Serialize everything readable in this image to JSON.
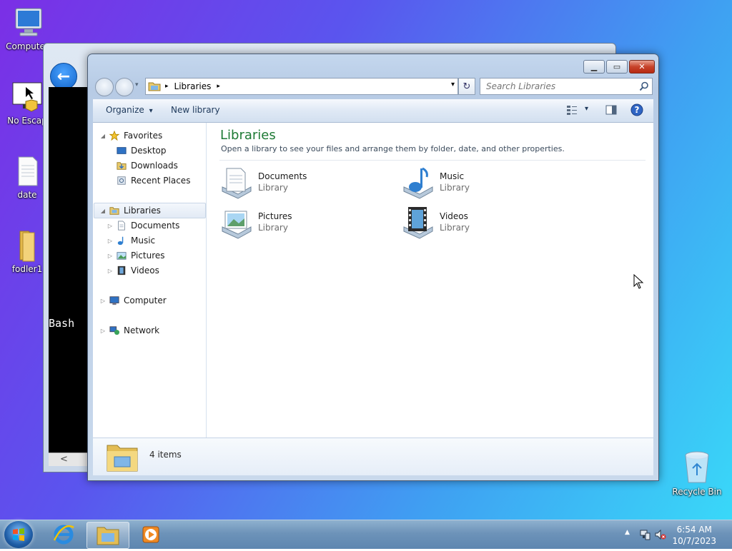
{
  "desktop": {
    "icons": [
      {
        "label": "Computer",
        "icon": "computer-icon"
      },
      {
        "label": "No Escap",
        "icon": "app-icon"
      },
      {
        "label": "date",
        "icon": "document-icon"
      },
      {
        "label": "fodler1",
        "icon": "folder-icon"
      },
      {
        "label": "Recycle Bin",
        "icon": "recycle-bin-icon"
      }
    ]
  },
  "background_window": {
    "terminal_text": "Bash",
    "back_glyph": "←",
    "scroll_glyph": "<"
  },
  "explorer": {
    "caption_buttons": {
      "minimize": "▁",
      "maximize": "▭",
      "close": "✕"
    },
    "address": {
      "root_arrow": "▸",
      "crumb": "Libraries",
      "crumb_arrow": "▸",
      "dropdown": "▾"
    },
    "refresh_glyph": "↻",
    "search": {
      "placeholder": "Search Libraries"
    },
    "toolbar": {
      "organize": "Organize",
      "organize_arrow": "▾",
      "new_library": "New library",
      "view_arrow": "▾"
    },
    "nav": {
      "favorites": "Favorites",
      "favorites_items": [
        "Desktop",
        "Downloads",
        "Recent Places"
      ],
      "libraries": "Libraries",
      "libraries_items": [
        "Documents",
        "Music",
        "Pictures",
        "Videos"
      ],
      "computer": "Computer",
      "network": "Network"
    },
    "main": {
      "title": "Libraries",
      "subtitle": "Open a library to see your files and arrange them by folder, date, and other properties.",
      "tiles": [
        {
          "name": "Documents",
          "type": "Library",
          "icon": "documents-library-icon"
        },
        {
          "name": "Music",
          "type": "Library",
          "icon": "music-library-icon"
        },
        {
          "name": "Pictures",
          "type": "Library",
          "icon": "pictures-library-icon"
        },
        {
          "name": "Videos",
          "type": "Library",
          "icon": "videos-library-icon"
        }
      ]
    },
    "details": {
      "item_count": "4 items"
    }
  },
  "taskbar": {
    "clock_time": "6:54 AM",
    "clock_date": "10/7/2023",
    "tray_arrow": "▲"
  },
  "colors": {
    "title_green": "#1e7a35",
    "toolbar_text": "#1e395b",
    "taskbar": "#6d93b9"
  }
}
